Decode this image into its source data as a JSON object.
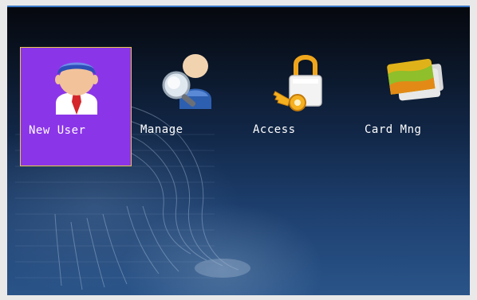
{
  "menu": {
    "items": [
      {
        "label": "New User",
        "icon": "user-icon",
        "selected": true
      },
      {
        "label": "Manage",
        "icon": "user-manage-icon",
        "selected": false
      },
      {
        "label": "Access",
        "icon": "lock-key-icon",
        "selected": false
      },
      {
        "label": "Card Mng",
        "icon": "card-icon",
        "selected": false
      }
    ]
  },
  "colors": {
    "selected_tile": "#8b35e8",
    "selected_border": "#e6c84a",
    "background_top": "#06080e",
    "background_bottom": "#2a5489",
    "label_text": "#ffffff"
  }
}
